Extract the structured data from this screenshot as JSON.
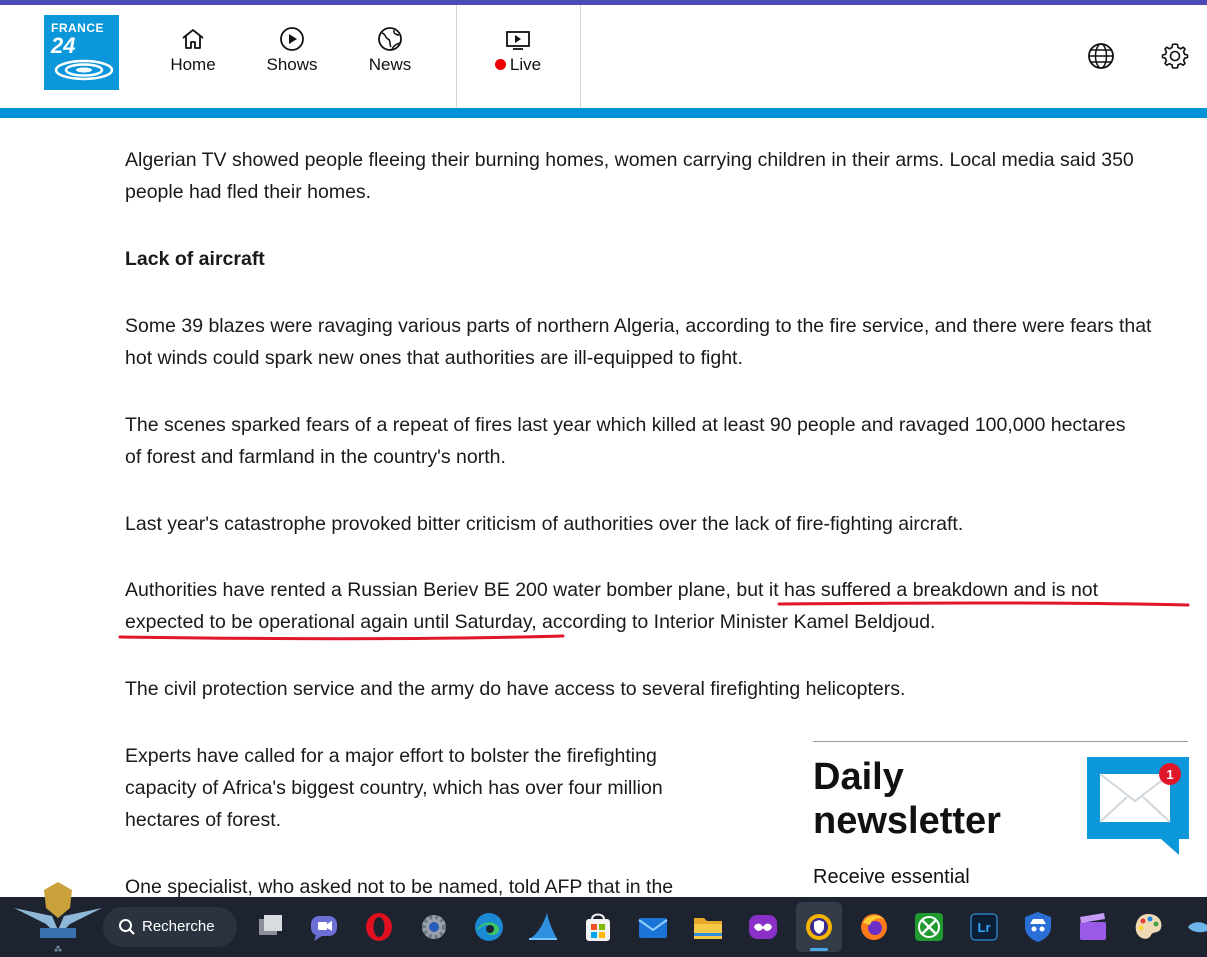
{
  "header": {
    "logo_line1": "FRANCE",
    "logo_line2": "24",
    "nav": [
      {
        "label": "Home",
        "icon": "home-icon"
      },
      {
        "label": "Shows",
        "icon": "play-circle-icon"
      },
      {
        "label": "News",
        "icon": "globe-icon"
      },
      {
        "label": "Live",
        "icon": "tv-icon"
      }
    ],
    "right_icons": [
      "language-globe-icon",
      "settings-gear-icon"
    ],
    "colors": {
      "accent_bar": "#0093d7",
      "top_line": "#4b4bb8",
      "logo_bg": "#0b97d9",
      "live_dot": "#ee0000"
    }
  },
  "article": {
    "p_algerian_tv": "Algerian TV showed people fleeing their burning homes, women carrying children in their arms. Local media said 350 people had fled their homes.",
    "heading_lack": "Lack of aircraft",
    "p_blazes": "Some 39 blazes were ravaging various parts of northern Algeria, according to the fire service, and there were fears that hot winds could spark new ones that authorities are ill-equipped to fight.",
    "p_scenes": "The scenes sparked fears of a repeat of fires last year which killed at least 90 people and ravaged 100,000 hectares of forest and farmland in the country's north.",
    "p_catastrophe": "Last year's catastrophe provoked bitter criticism of authorities over the lack of fire-fighting aircraft.",
    "p_authorities_a": "Authorities have rented a Russian Beriev BE 200 water bomber plane, ",
    "p_authorities_b": "but it has suffered a breakdown and is not",
    "p_authorities_c": "expected to be operational again until Saturday",
    "p_authorities_d": ", according to Interior Minister Kamel Beldjoud.",
    "p_civil": "The civil protection service and the army do have access to several firefighting helicopters.",
    "p_experts": "Experts have called for a major effort to bolster the firefighting capacity of Africa's biggest country, which has over four million hectares of forest.",
    "p_specialist": "One specialist, who asked not to be named, told AFP that in the",
    "annotation_color": "#e0162b"
  },
  "newsletter": {
    "title": "Daily newsletter",
    "desc": "Receive essential",
    "badge_count": "1",
    "icon": "mail-envelope-icon"
  },
  "taskbar": {
    "search_label": "Recherche",
    "apps": [
      "start-icon",
      "task-view-icon",
      "teams-chat-icon",
      "opera-icon",
      "settings-app-icon",
      "edge-icon",
      "shark-app-icon",
      "store-icon",
      "mail-icon",
      "file-explorer-icon",
      "mask-app-icon",
      "browser-shield-icon",
      "firefox-icon",
      "xbox-icon",
      "lightroom-icon",
      "spy-app-icon",
      "clapper-app-icon",
      "paint-icon",
      "more-icon"
    ],
    "active_app": "browser-shield-icon"
  }
}
